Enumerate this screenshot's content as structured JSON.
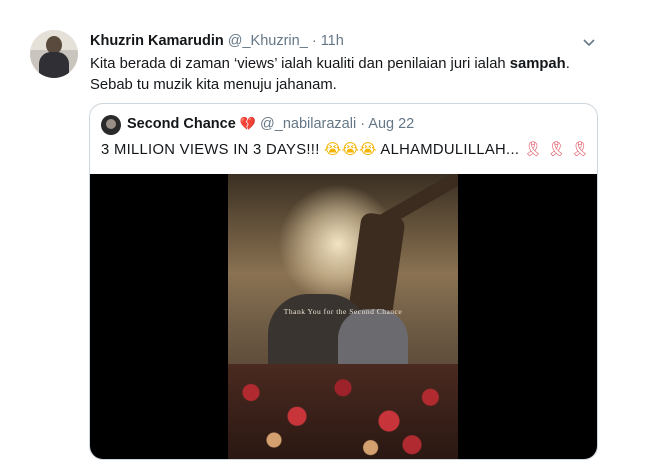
{
  "tweet": {
    "name": "Khuzrin Kamarudin",
    "handle": "@_Khuzrin_",
    "separator": "·",
    "time": "11h",
    "text_line1_prefix": "Kita berada di zaman ‘views’ ialah kualiti dan penilaian juri ialah ",
    "text_line1_bold": "sampah",
    "text_line1_suffix": ".",
    "text_line2": "Sebab tu muzik kita menuju jahanam."
  },
  "quoted": {
    "name": "Second Chance",
    "heart_emoji": "💔",
    "handle": "@_nabilarazali",
    "separator": "·",
    "date": "Aug 22",
    "text_main": "3 MILLION VIEWS IN 3 DAYS!!! ",
    "crying_emojis": "😭😭😭",
    "text_after": " ALHAMDULILLAH... ",
    "ribbon_emojis": "🎗 🎗 🎗",
    "video_caption": "Thank You for the Second Chance"
  },
  "icons": {
    "menu": "chevron-down-icon"
  },
  "colors": {
    "text": "#14171a",
    "muted": "#657786",
    "border": "#ccd6dd"
  }
}
